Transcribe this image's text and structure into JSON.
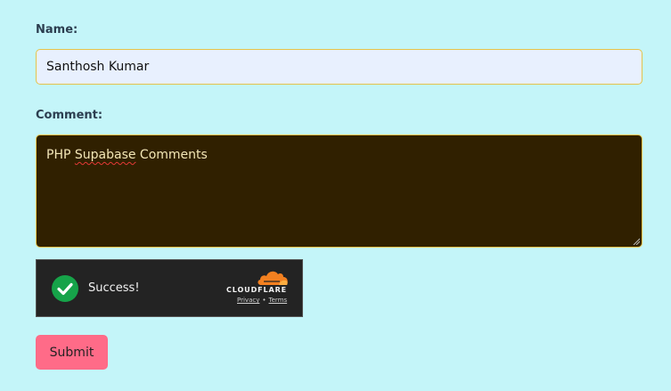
{
  "form": {
    "name_label": "Name:",
    "name_value": "Santhosh Kumar",
    "comment_label": "Comment:",
    "comment_value_prefix": "PHP ",
    "comment_value_misspelled": "Supabase",
    "comment_value_suffix": " Comments",
    "submit_label": "Submit"
  },
  "captcha": {
    "status_text": "Success!",
    "status_icon": "check-circle-icon",
    "brand": "CLOUDFLARE",
    "privacy_label": "Privacy",
    "separator": "•",
    "terms_label": "Terms"
  },
  "colors": {
    "background": "#c4f5f9",
    "name_input_bg": "#e8f0fe",
    "comment_bg": "#302000",
    "input_border": "#e6c34a",
    "captcha_bg": "#232323",
    "success_green": "#16a349",
    "cloudflare_orange": "#f38020",
    "submit_bg": "#ff6b88"
  }
}
